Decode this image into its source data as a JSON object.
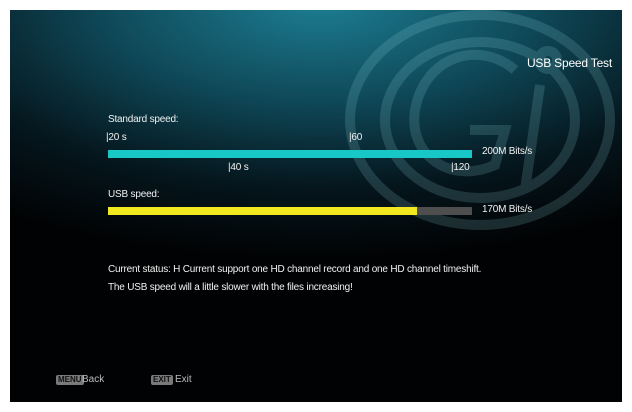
{
  "title": "USB Speed Test",
  "standard": {
    "label": "Standard speed:",
    "ticks_top": [
      "|20 s",
      "|60"
    ],
    "ticks_bottom": [
      "|40 s",
      "|120"
    ],
    "value": "200M Bits/s"
  },
  "usb": {
    "label": "USB speed:",
    "value": "170M Bits/s",
    "fill_fraction": 0.85
  },
  "status": {
    "line1": "Current status: H Current support one HD channel record and one HD channel timeshift.",
    "line2": "The USB speed will a little slower with the files increasing!"
  },
  "footer": {
    "menu_key": "MENU",
    "menu_label": "Back",
    "exit_key": "EXIT",
    "exit_label": "Exit"
  },
  "colors": {
    "standard_bar": "#18c8c6",
    "usb_bar": "#f2e81f",
    "usb_track": "#4e4e4e"
  },
  "icons": {
    "watermark": "gi-logo-watermark"
  }
}
